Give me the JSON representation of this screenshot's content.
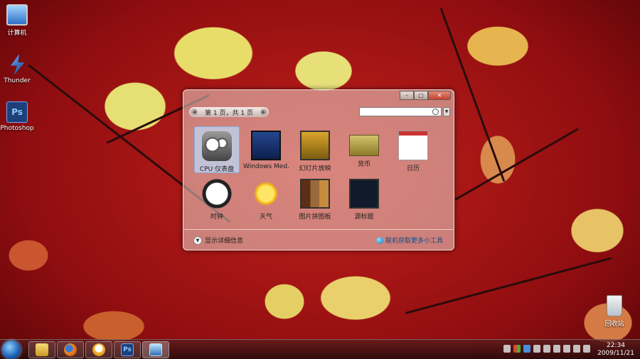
{
  "desktop": {
    "icons": [
      {
        "label": "计算机",
        "icon": "computer-icon"
      },
      {
        "label": "Thunder",
        "icon": "thunder-icon"
      },
      {
        "label": "Photoshop",
        "icon": "photoshop-icon"
      },
      {
        "label": "回收站",
        "icon": "recycle-bin-icon"
      }
    ],
    "photoshop_glyph": "Ps"
  },
  "gallery": {
    "page_label": "第 1 页，共 1 页",
    "search_placeholder": "",
    "gadgets": [
      {
        "name": "CPU 仪表盘",
        "selected": true
      },
      {
        "name": "Windows Med...",
        "selected": false
      },
      {
        "name": "幻灯片放映",
        "selected": false
      },
      {
        "name": "货币",
        "selected": false
      },
      {
        "name": "日历",
        "selected": false
      },
      {
        "name": "时钟",
        "selected": false
      },
      {
        "name": "天气",
        "selected": false
      },
      {
        "name": "图片拼图板",
        "selected": false
      },
      {
        "name": "源标题",
        "selected": false
      }
    ],
    "show_details": "显示详细信息",
    "get_more_online": "联机获取更多小工具"
  },
  "taskbar": {
    "pinned": [
      "explorer-icon",
      "firefox-icon",
      "qq-icon",
      "photoshop-icon",
      "remote-desktop-icon"
    ],
    "photoshop_glyph": "Ps",
    "clock_time": "22:34",
    "clock_date": "2009/11/21"
  },
  "colors": {
    "desktop_red": "#b0151a",
    "taskbar": "#3a0f0f",
    "link_blue": "#0e4e8c"
  }
}
